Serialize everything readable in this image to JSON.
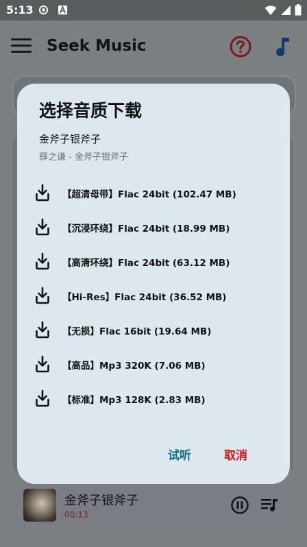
{
  "status_bar": {
    "time": "5:13"
  },
  "app_bar": {
    "title": "Seek Music"
  },
  "dialog": {
    "title": "选择音质下载",
    "song_title": "金斧子银斧子",
    "subtitle": "薛之谦 - 金斧子银斧子",
    "options": [
      {
        "label": "【超清母带】Flac 24bit (102.47 MB)"
      },
      {
        "label": "【沉浸环绕】Flac 24bit (18.99 MB)"
      },
      {
        "label": "【高清环绕】Flac 24bit (63.12 MB)"
      },
      {
        "label": "【Hi-Res】Flac 24bit (36.52 MB)"
      },
      {
        "label": "【无损】Flac 16bit (19.64 MB)"
      },
      {
        "label": "【高品】Mp3 320K (7.06 MB)"
      },
      {
        "label": "【标准】Mp3 128K (2.83 MB)"
      }
    ],
    "listen_label": "试听",
    "cancel_label": "取消"
  },
  "player": {
    "title": "金斧子银斧子",
    "time": "00:13"
  },
  "colors": {
    "accent_red": "#d51a1a",
    "accent_teal": "#0a6e86",
    "note_blue": "#123a6e"
  }
}
